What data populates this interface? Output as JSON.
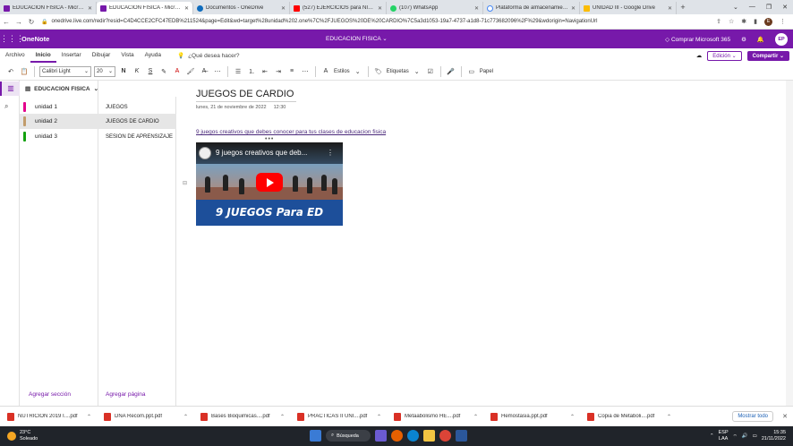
{
  "browser": {
    "tabs": [
      {
        "title": "EDUCACION FISICA - Microsoft",
        "color": "#7719aa",
        "active": false
      },
      {
        "title": "EDUCACION FISICA - Microsoft",
        "color": "#7719aa",
        "active": true
      },
      {
        "title": "Documentos - OneDrive",
        "color": "#0f6cbd",
        "active": false
      },
      {
        "title": "(527) EJERCICIOS para NIÑOS d",
        "color": "#ff0000",
        "active": false
      },
      {
        "title": "(107) WhatsApp",
        "color": "#25d366",
        "active": false
      },
      {
        "title": "Plataforma de almacenamiento",
        "color": "#777777",
        "active": false
      },
      {
        "title": "UNIDAD III - Google Drive",
        "color": "#fbbc04",
        "active": false
      }
    ],
    "url": "onedrive.live.com/redir?resid=C4D4CCE2CFC47EDB%211524&page=Edit&wd=target%28unidad%202.one%7C%2FJUEGOS%20DE%20CARDIO%7C5a3d1053-19a7-4737-a1d8-71c773682096%2F%29&wdorigin=NavigationUrl"
  },
  "app": {
    "name": "OneNote",
    "doc_title": "EDUCACION FISICA ⌄",
    "buy": "Comprar Microsoft 365",
    "initials": "EP"
  },
  "menu": {
    "items": [
      "Archivo",
      "Inicio",
      "Insertar",
      "Dibujar",
      "Vista",
      "Ayuda"
    ],
    "tell_me": "¿Qué desea hacer?",
    "edicion": "Edición ⌄",
    "compartir": "Compartir ⌄"
  },
  "ribbon": {
    "font": "Calibri Light",
    "size": "20",
    "estilos": "Estilos",
    "etiquetas": "Etiquetas",
    "papel": "Papel"
  },
  "notebook": {
    "title": "EDUCACION FISICA",
    "sections": [
      {
        "label": "unidad 1",
        "color": "#e3008c"
      },
      {
        "label": "unidad 2",
        "color": "#c19c6b"
      },
      {
        "label": "unidad 3",
        "color": "#13a10e"
      }
    ],
    "pages": [
      "JUEGOS",
      "JUEGOS DE CARDIO",
      "SESION DE APRENSIZAJE"
    ],
    "add_section": "Agregar sección",
    "add_page": "Agregar página"
  },
  "page": {
    "title": "JUEGOS DE CARDIO",
    "date": "lunes, 21 de noviembre de 2022",
    "time": "12:30",
    "link": "9 juegos creativos que debes conocer para tus clases de educacion fisica",
    "video_title": "9 juegos creativos que deb...",
    "video_banner": "9 JUEGOS Para ED FÍSICA"
  },
  "downloads": {
    "items": [
      "NUTRICIÓN 2019 I....pdf",
      "DNA Recom.ppt.pdf",
      "Bases Bioquimicas....pdf",
      "PRÁCTICAS II UNI....pdf",
      "Metaabolismo HE....pdf",
      "Hemostasia.ppt.pdf",
      "Copia de Metaboli....pdf"
    ],
    "show_all": "Mostrar todo"
  },
  "taskbar": {
    "temp": "23°C",
    "weather": "Soleado",
    "search": "Búsqueda",
    "lang1": "ESP",
    "lang2": "LAA",
    "time": "15:35",
    "date": "21/11/2022"
  }
}
